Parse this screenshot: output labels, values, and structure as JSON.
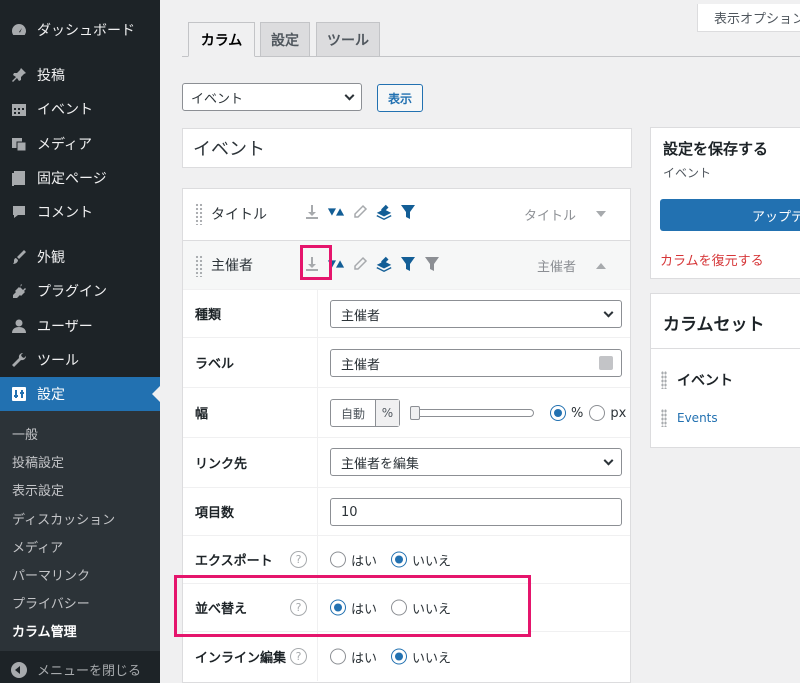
{
  "sidebar": {
    "items": [
      {
        "label": "ダッシュボード",
        "icon": "dashboard-icon"
      },
      {
        "label": "投稿",
        "icon": "pin-icon"
      },
      {
        "label": "イベント",
        "icon": "calendar-icon"
      },
      {
        "label": "メディア",
        "icon": "media-icon"
      },
      {
        "label": "固定ページ",
        "icon": "page-icon"
      },
      {
        "label": "コメント",
        "icon": "comment-icon"
      },
      {
        "label": "外観",
        "icon": "brush-icon"
      },
      {
        "label": "プラグイン",
        "icon": "plugin-icon"
      },
      {
        "label": "ユーザー",
        "icon": "user-icon"
      },
      {
        "label": "ツール",
        "icon": "wrench-icon"
      },
      {
        "label": "設定",
        "icon": "settings-icon"
      }
    ],
    "submenu": [
      "一般",
      "投稿設定",
      "表示設定",
      "ディスカッション",
      "メディア",
      "パーマリンク",
      "プライバシー",
      "カラム管理"
    ],
    "collapse_label": "メニューを閉じる"
  },
  "screen_options": "表示オプション",
  "tabs": [
    "カラム",
    "設定",
    "ツール"
  ],
  "list_select": "イベント",
  "show_button": "表示",
  "list_title": "イベント",
  "columns": [
    {
      "name": "タイトル",
      "label": "タイトル"
    },
    {
      "name": "主催者",
      "label": "主催者"
    }
  ],
  "settings": {
    "type": {
      "label": "種類",
      "value": "主催者"
    },
    "label": {
      "label": "ラベル",
      "value": "主催者"
    },
    "width": {
      "label": "幅",
      "auto": "自動",
      "unit": "%",
      "options": [
        "%",
        "px"
      ]
    },
    "link": {
      "label": "リンク先",
      "value": "主催者を編集"
    },
    "count": {
      "label": "項目数",
      "value": "10"
    },
    "export": {
      "label": "エクスポート",
      "yes": "はい",
      "no": "いいえ"
    },
    "sort": {
      "label": "並べ替え",
      "yes": "はい",
      "no": "いいえ"
    },
    "inline": {
      "label": "インライン編集",
      "yes": "はい",
      "no": "いいえ"
    }
  },
  "help_glyph": "?",
  "save_box": {
    "title": "設定を保存する",
    "subtitle": "イベント",
    "button": "アップデート",
    "restore": "カラムを復元する"
  },
  "column_sets": {
    "title": "カラムセット",
    "item": "イベント",
    "link": "Events"
  },
  "colors": {
    "accent": "#2271b1",
    "highlight": "#e5156c",
    "sidebar": "#1d2327",
    "restore": "#d63638"
  }
}
